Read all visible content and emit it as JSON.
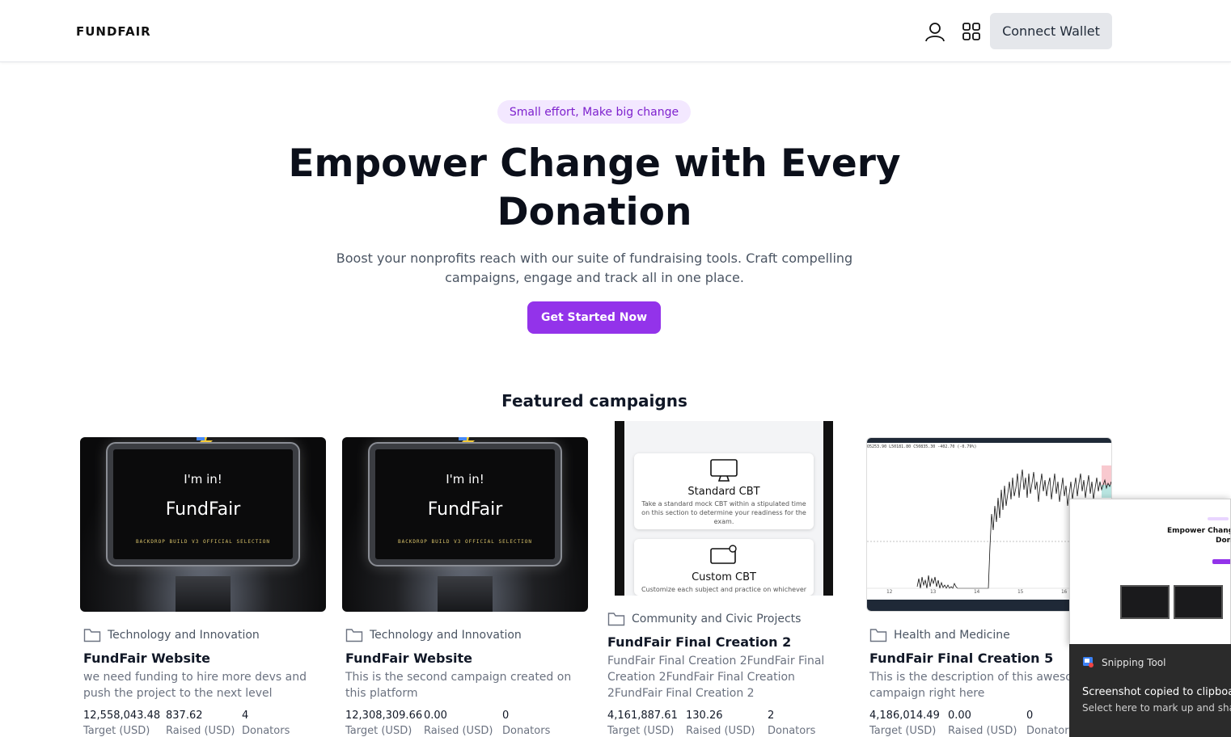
{
  "header": {
    "logo": "FUNDFAIR",
    "connect_label": "Connect Wallet",
    "icons": [
      "user-icon",
      "grid-icon"
    ]
  },
  "hero": {
    "pill": "Small effort, Make big change",
    "title_line1": "Empower Change with Every",
    "title_line2": "Donation",
    "sub_line1": "Boost your nonprofits reach with our suite of fundraising tools. Craft compelling",
    "sub_line2": "campaigns, engage and track all in one place.",
    "cta": "Get Started Now"
  },
  "featured_title": "Featured campaigns",
  "thumb_text": {
    "im_in": "I'm in!",
    "fundfair": "FundFair",
    "backdrop": "BACKDROP BUILD V3 OFFICIAL SELECTION",
    "cbt_standard": "Standard CBT",
    "cbt_standard_desc": "Take a standard mock CBT within a stipulated time on this section to determine your readiness for the exam.",
    "cbt_custom": "Custom CBT",
    "cbt_custom_desc": "Customize each subject and practice on whichever",
    "chart_header": "O5253.90 L50181.80 C50835.30 -402.70 (-0.79%)",
    "chart_ticks": [
      "12",
      "13",
      "14",
      "15",
      "16"
    ]
  },
  "campaigns": [
    {
      "category": "Technology and Innovation",
      "title": "FundFair Website",
      "desc": "we need funding to hire more devs and push the project to the next level",
      "target": "12,558,043.48",
      "raised": "837.62",
      "donators": "4"
    },
    {
      "category": "Technology and Innovation",
      "title": "FundFair Website",
      "desc": "This is the second campaign created on this platform",
      "target": "12,308,309.66",
      "raised": "0.00",
      "donators": "0"
    },
    {
      "category": "Community and Civic Projects",
      "title": "FundFair Final Creation 2",
      "desc": "FundFair Final Creation 2FundFair Final Creation 2FundFair Final Creation 2FundFair Final Creation 2",
      "target": "4,161,887.61",
      "raised": "130.26",
      "donators": "2"
    },
    {
      "category": "Health and Medicine",
      "title": "FundFair Final Creation 5",
      "desc": "This is the description of this awesome campaign right here",
      "target": "4,186,014.49",
      "raised": "0.00",
      "donators": "0"
    }
  ],
  "stat_labels": {
    "target": "Target (USD)",
    "raised": "Raised (USD)",
    "donators": "Donators"
  },
  "snipping": {
    "preview_title1": "Empower Chang",
    "preview_title2": "Donati",
    "app_name": "Snipping Tool",
    "line1": "Screenshot copied to clipboard",
    "line2": "Select here to mark up and share"
  },
  "colors": {
    "accent": "#9333ea",
    "pill_bg": "#f3e8ff",
    "pill_text": "#7e22ce"
  }
}
